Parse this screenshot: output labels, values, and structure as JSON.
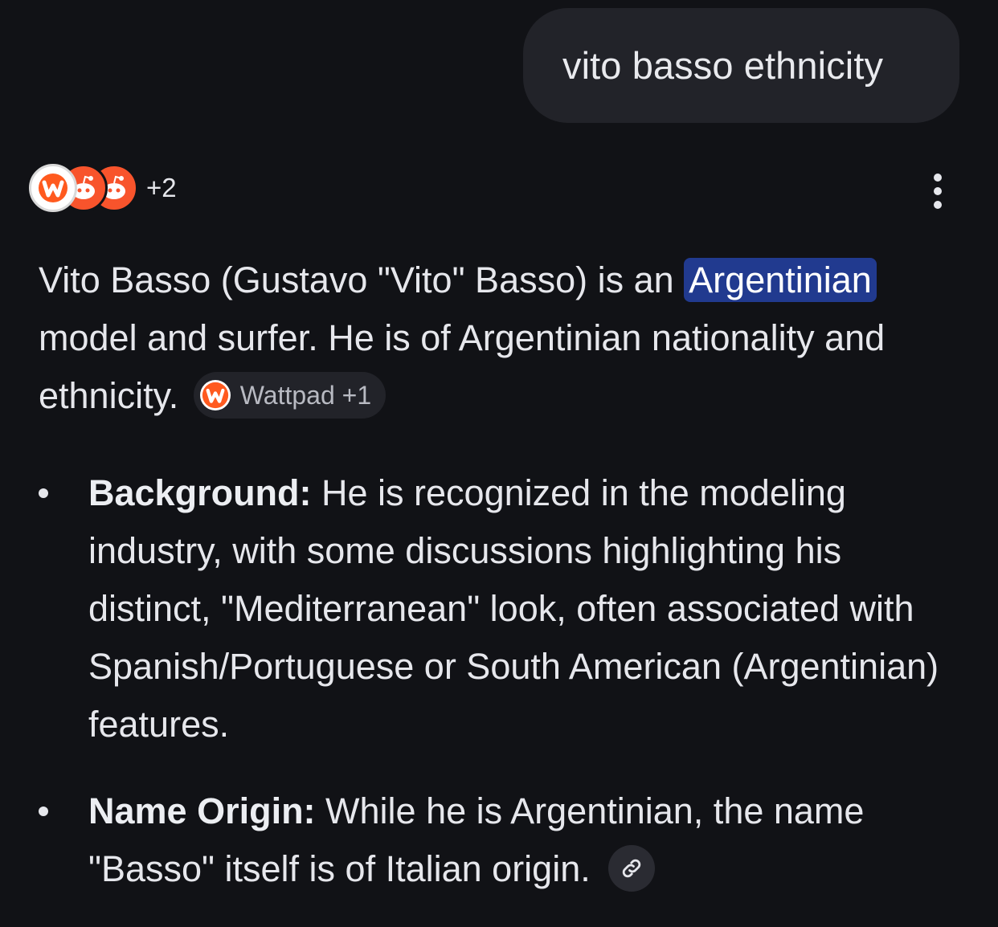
{
  "query": {
    "text": "vito basso ethnicity"
  },
  "sources": {
    "icons": [
      "wattpad-icon",
      "reddit-icon",
      "reddit-icon"
    ],
    "more_count": "+2"
  },
  "answer": {
    "intro_before": "Vito Basso (Gustavo \"Vito\" Basso) is an ",
    "intro_highlight": "Argentinian",
    "intro_after": " model and surfer. He is of Argentinian nationality and ethnicity.",
    "citation_chip": {
      "label": "Wattpad +1",
      "icon": "wattpad-icon"
    }
  },
  "bullets": [
    {
      "title": "Background:",
      "text": " He is recognized in the modeling industry, with some discussions highlighting his distinct, \"Mediterranean\" look, often associated with Spanish/Portuguese or South American (Argentinian) features."
    },
    {
      "title": "Name Origin:",
      "text": " While he is Argentinian, the name \"Basso\" itself is of Italian origin."
    }
  ],
  "colors": {
    "background": "#111216",
    "bubble": "#222329",
    "highlight": "#213a8f",
    "wattpad": "#ff5a1f",
    "reddit": "#f8542c"
  }
}
